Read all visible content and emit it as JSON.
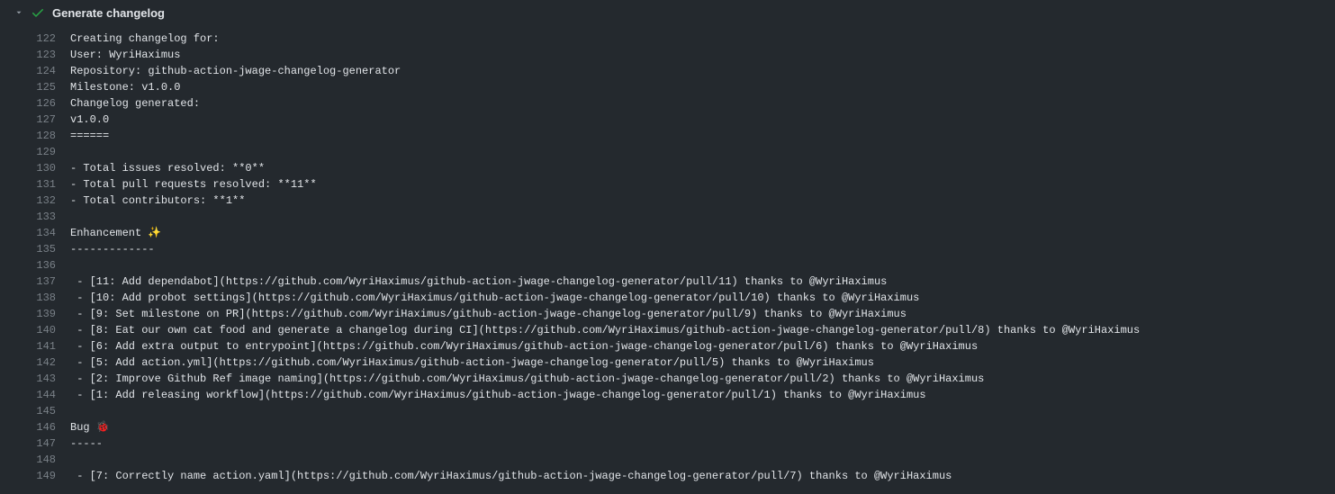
{
  "step": {
    "title": "Generate changelog"
  },
  "lines": [
    {
      "num": "122",
      "text": "Creating changelog for:"
    },
    {
      "num": "123",
      "text": "User: WyriHaximus"
    },
    {
      "num": "124",
      "text": "Repository: github-action-jwage-changelog-generator"
    },
    {
      "num": "125",
      "text": "Milestone: v1.0.0"
    },
    {
      "num": "126",
      "text": "Changelog generated:"
    },
    {
      "num": "127",
      "text": "v1.0.0"
    },
    {
      "num": "128",
      "text": "======"
    },
    {
      "num": "129",
      "text": ""
    },
    {
      "num": "130",
      "text": "- Total issues resolved: **0**"
    },
    {
      "num": "131",
      "text": "- Total pull requests resolved: **11**"
    },
    {
      "num": "132",
      "text": "- Total contributors: **1**"
    },
    {
      "num": "133",
      "text": ""
    },
    {
      "num": "134",
      "text": "Enhancement ✨"
    },
    {
      "num": "135",
      "text": "-------------"
    },
    {
      "num": "136",
      "text": ""
    },
    {
      "num": "137",
      "text": " - [11: Add dependabot](https://github.com/WyriHaximus/github-action-jwage-changelog-generator/pull/11) thanks to @WyriHaximus"
    },
    {
      "num": "138",
      "text": " - [10: Add probot settings](https://github.com/WyriHaximus/github-action-jwage-changelog-generator/pull/10) thanks to @WyriHaximus"
    },
    {
      "num": "139",
      "text": " - [9: Set milestone on PR](https://github.com/WyriHaximus/github-action-jwage-changelog-generator/pull/9) thanks to @WyriHaximus"
    },
    {
      "num": "140",
      "text": " - [8: Eat our own cat food and generate a changelog during CI](https://github.com/WyriHaximus/github-action-jwage-changelog-generator/pull/8) thanks to @WyriHaximus"
    },
    {
      "num": "141",
      "text": " - [6: Add extra output to entrypoint](https://github.com/WyriHaximus/github-action-jwage-changelog-generator/pull/6) thanks to @WyriHaximus"
    },
    {
      "num": "142",
      "text": " - [5: Add action.yml](https://github.com/WyriHaximus/github-action-jwage-changelog-generator/pull/5) thanks to @WyriHaximus"
    },
    {
      "num": "143",
      "text": " - [2: Improve Github Ref image naming](https://github.com/WyriHaximus/github-action-jwage-changelog-generator/pull/2) thanks to @WyriHaximus"
    },
    {
      "num": "144",
      "text": " - [1: Add releasing workflow](https://github.com/WyriHaximus/github-action-jwage-changelog-generator/pull/1) thanks to @WyriHaximus"
    },
    {
      "num": "145",
      "text": ""
    },
    {
      "num": "146",
      "text": "Bug 🐞"
    },
    {
      "num": "147",
      "text": "-----"
    },
    {
      "num": "148",
      "text": ""
    },
    {
      "num": "149",
      "text": " - [7: Correctly name action.yaml](https://github.com/WyriHaximus/github-action-jwage-changelog-generator/pull/7) thanks to @WyriHaximus"
    }
  ]
}
